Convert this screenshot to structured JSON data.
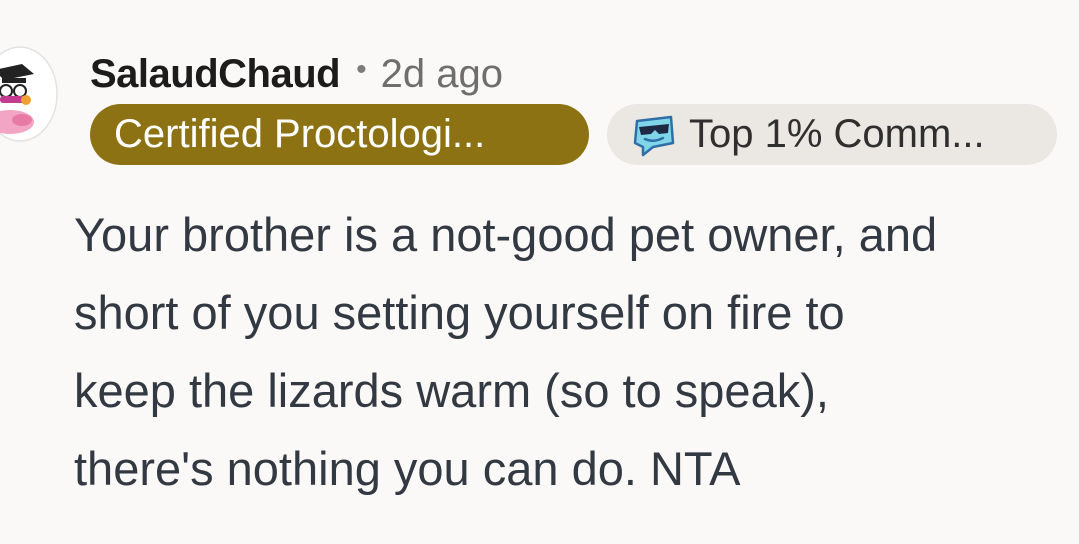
{
  "comment": {
    "author": "SalaudChaud",
    "separator": "•",
    "time_ago": "2d ago",
    "user_flair": "Certified Proctologi...",
    "achievement_flair": {
      "icon": "cool-snoo-sunglasses-icon",
      "label": "Top 1% Comm..."
    },
    "body_lines": [
      "Your brother is a not-good pet owner, and",
      "short of you setting yourself on fire to",
      "keep the lizards warm (so to speak),",
      "there's nothing you can do. NTA"
    ]
  },
  "colors": {
    "background": "#fbf9f7",
    "user_flair_bg": "#8c7212",
    "achievement_flair_bg": "#ebe7e3",
    "body_text": "#323942"
  }
}
